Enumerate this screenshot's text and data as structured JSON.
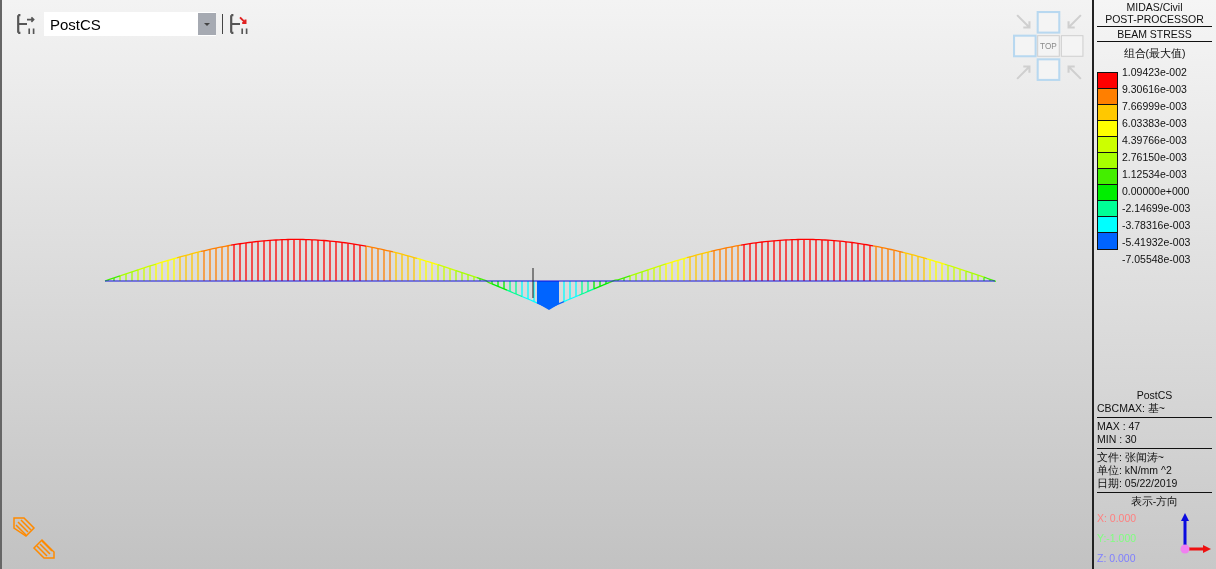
{
  "toolbar": {
    "stage": "PostCS"
  },
  "view_cube": {
    "label": "TOP"
  },
  "panel": {
    "header": [
      "MIDAS/Civil",
      "POST-PROCESSOR"
    ],
    "result_type": "BEAM STRESS",
    "component": "组合(最大值)",
    "legend_labels": [
      "1.09423e-002",
      "9.30616e-003",
      "7.66999e-003",
      "6.03383e-003",
      "4.39766e-003",
      "2.76150e-003",
      "1.12534e-003",
      "0.00000e+000",
      "-2.14699e-003",
      "-3.78316e-003",
      "-5.41932e-003",
      "-7.05548e-003"
    ],
    "legend_bands": [
      {
        "color": "#ff0000"
      },
      {
        "color": "#ff7f00"
      },
      {
        "color": "#ffc800"
      },
      {
        "color": "#ffff00"
      },
      {
        "color": "#ccff00"
      },
      {
        "color": "#a8ff00"
      },
      {
        "color": "#44ee00"
      },
      {
        "color": "#00ee00"
      },
      {
        "color": "#00ff96"
      },
      {
        "color": "#00ffff"
      },
      {
        "color": "#0064ff"
      }
    ],
    "stage": "PostCS",
    "case": "CBCMAX: 基~",
    "extremes": [
      "MAX : 47",
      "MIN : 30"
    ],
    "meta": [
      "文件: 张闻涛~",
      "单位: kN/mm ^2",
      "日期: 05/22/2019"
    ],
    "direction_title": "表示-方向",
    "direction": [
      {
        "text": "X: 0.000",
        "color": "#ff7f7f"
      },
      {
        "text": "Y:-1.000",
        "color": "#7fff7f"
      },
      {
        "text": "Z: 0.000",
        "color": "#7f7fff"
      }
    ]
  }
}
